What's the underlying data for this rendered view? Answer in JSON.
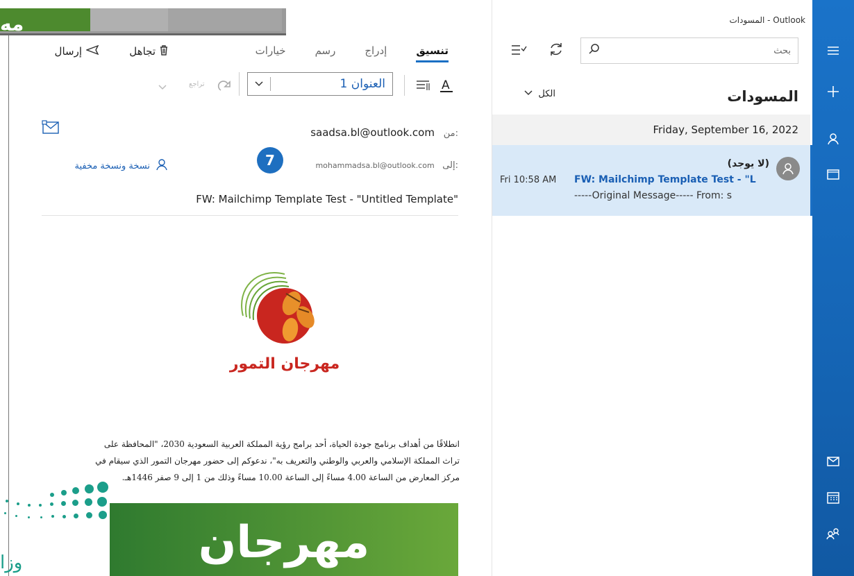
{
  "window": {
    "title": "المسودات - Outlook"
  },
  "overlay": {
    "fragment_text": "مه"
  },
  "nav_rail": {
    "icons": [
      "hamburger-icon",
      "plus-icon",
      "person-icon",
      "folder-icon",
      "mail-icon",
      "calendar-icon",
      "people-icon"
    ]
  },
  "folder_pane": {
    "search_placeholder": "بحث",
    "folder_title": "المسودات",
    "filter_label": "الكل",
    "date_header": "Friday, September 16, 2022",
    "message": {
      "sender": "(لا يوجد)",
      "subject": "FW: Mailchimp Template Test - \"L",
      "time": "Fri 10:58 AM",
      "preview": "-----Original Message----- From: s"
    }
  },
  "ribbon": {
    "tabs": [
      "تنسيق",
      "إدراج",
      "رسم",
      "خيارات"
    ],
    "send_label": "إرسال",
    "discard_label": "تجاهل",
    "style_value": "العنوان 1",
    "undo_label": "تراجع"
  },
  "compose": {
    "from_label": "من:",
    "from_value": "saadsa.bl@outlook.com",
    "to_label": "إلى:",
    "to_value": "mohammadsa.bl@outlook.com",
    "cc_bcc_label": "نسخة ونسخة مخفية",
    "subject": "FW: Mailchimp Template Test - \"Untitled Template\"",
    "logo_caption": "مهرجان التمور",
    "body_line1": "انطلاقًا من أهداف برنامج جودة الحياة، أحد برامج رؤية المملكة العربية السعودية 2030، \"المحافظة على",
    "body_line2": "تراث المملكة الإسلامي والعربي والوطني والتعريف به\"، ندعوكم إلى حضور مهرجان التمور الذي سيقام في",
    "body_line3": "مركز المعارض من الساعة 4.00 مساءً إلى الساعة 10.00 مساءً وذلك من 1 إلى 9 صفر 1446هـ.",
    "banner_text": "مهرجان"
  },
  "callout": {
    "number": "7"
  },
  "corner_logo_text": "وزا",
  "colors": {
    "rail": "#1565b5",
    "selected": "#d9e9f8",
    "accent": "#1a5fb4",
    "banner": "#4f962f"
  }
}
